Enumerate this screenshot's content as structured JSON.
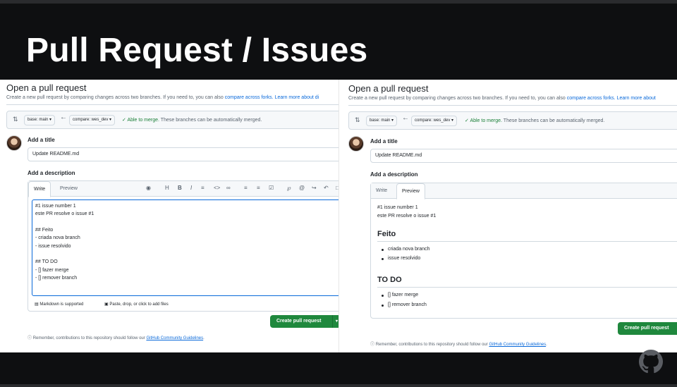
{
  "slide": {
    "title": "Pull Request / Issues"
  },
  "left_panel": {
    "heading": "Open a pull request",
    "subtext_prefix": "Create a new pull request by comparing changes across two branches. If you need to, you can also",
    "compare_forks_link": "compare across forks.",
    "learn_more_link": "Learn more about di",
    "base_branch": "base: main",
    "compare_branch": "compare: wes_dev",
    "merge_status": "Able to merge.",
    "merge_detail": "These branches can be automatically merged.",
    "add_title_label": "Add a title",
    "title_value": "Update README.md",
    "add_description_label": "Add a description",
    "tab_write": "Write",
    "tab_preview": "Preview",
    "toolbar_icons": [
      "copilot-icon",
      "heading-icon",
      "bold-icon",
      "italic-icon",
      "quote-icon",
      "code-icon",
      "link-icon",
      "ordered-list-icon",
      "unordered-list-icon",
      "task-list-icon",
      "attach-icon",
      "mention-icon",
      "reference-icon",
      "undo-icon",
      "fullscreen-icon"
    ],
    "editor_lines": [
      "#1 issue number 1",
      "este PR resolve o issue #1",
      "",
      "## Feito",
      "- criada nova branch",
      "- issue resolvido",
      "",
      "## TO DO",
      "- [] fazer merge",
      "- [] remover branch"
    ],
    "markdown_supported": "Markdown is supported",
    "paste_drop": "Paste, drop, or click to add files",
    "create_button": "Create pull request",
    "note_prefix": "Remember, contributions to this repository should follow our",
    "note_link": "GitHub Community Guidelines",
    "note_suffix": "."
  },
  "right_panel": {
    "heading": "Open a pull request",
    "subtext_prefix": "Create a new pull request by comparing changes across two branches. If you need to, you can also",
    "compare_forks_link": "compare across forks.",
    "learn_more_link": "Learn more about",
    "base_branch": "base: main",
    "compare_branch": "compare: wes_dev",
    "merge_status": "Able to merge.",
    "merge_detail": "These branches can be automatically merged.",
    "add_title_label": "Add a title",
    "title_value": "Update README.md",
    "add_description_label": "Add a description",
    "tab_write": "Write",
    "tab_preview": "Preview",
    "preview_intro": [
      "#1 issue number 1",
      "este PR resolve o issue #1"
    ],
    "preview_h1": "Feito",
    "preview_list1": [
      "criada nova branch",
      "issue resolvido"
    ],
    "preview_h2": "TO DO",
    "preview_list2": [
      "[] fazer merge",
      "[] remover branch"
    ],
    "create_button": "Create pull request",
    "note_prefix": "Remember, contributions to this repository should follow our",
    "note_link": "GitHub Community Guidelines",
    "note_suffix": "."
  },
  "icons": {
    "github_logo": "github-logo-icon",
    "merge_check": "check-icon",
    "compare_arrow": "arrow-left-icon",
    "git_compare": "git-compare-icon",
    "info": "info-icon"
  },
  "colors": {
    "slide_bg": "#0e0f11",
    "accent_green": "#1f883d",
    "link_blue": "#0969da",
    "success_green": "#1a7f37"
  }
}
